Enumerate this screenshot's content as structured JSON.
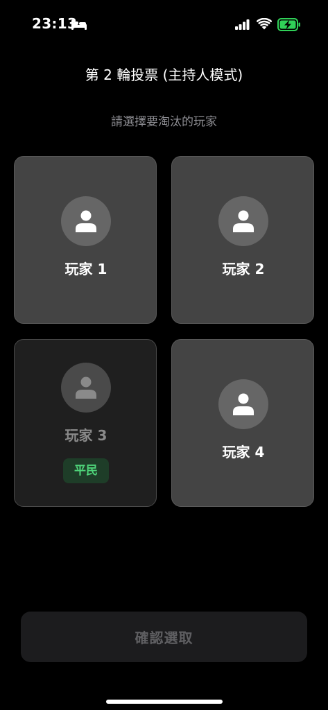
{
  "status_bar": {
    "time": "23:13",
    "icons": [
      "bed-icon",
      "signal-icon",
      "wifi-icon",
      "battery-charging-icon"
    ],
    "battery_color": "#30d158"
  },
  "header": {
    "title": "第 2 輪投票 (主持人模式)",
    "subtitle": "請選擇要淘汰的玩家"
  },
  "players": [
    {
      "name": "玩家 1",
      "eliminated": false
    },
    {
      "name": "玩家 2",
      "eliminated": false
    },
    {
      "name": "玩家 3",
      "eliminated": true,
      "role": "平民"
    },
    {
      "name": "玩家 4",
      "eliminated": false
    }
  ],
  "confirm_label": "確認選取",
  "colors": {
    "background": "#000000",
    "card": "#444444",
    "card_eliminated": "#1f1f1f",
    "role_text": "#4fd57a",
    "role_bg": "#1e3d28",
    "subtitle": "#8e8e93"
  }
}
